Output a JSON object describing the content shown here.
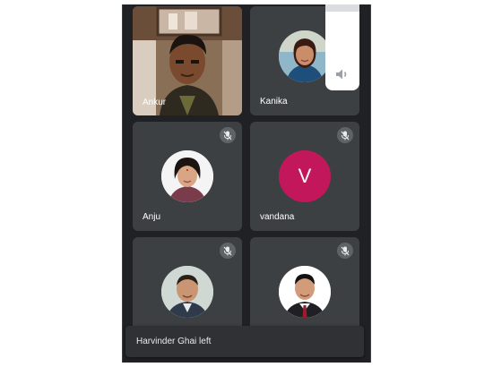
{
  "participants": [
    {
      "name": "Ankur",
      "type": "video",
      "muted": false
    },
    {
      "name": "Kanika",
      "type": "photo",
      "muted": false
    },
    {
      "name": "Anju",
      "type": "photo",
      "muted": true
    },
    {
      "name": "vandana",
      "type": "letter",
      "initial": "V",
      "avatar_color": "#c2185b",
      "muted": true
    },
    {
      "name": "",
      "type": "photo",
      "muted": true
    },
    {
      "name": "",
      "type": "photo",
      "muted": true
    }
  ],
  "volume_panel": {
    "icon": "speaker-icon",
    "level": 0.08
  },
  "toast": {
    "message": "Harvinder Ghai left"
  },
  "icons": {
    "mute": "mic-off-icon"
  },
  "colors": {
    "background": "#202124",
    "tile": "#3c4043",
    "toast": "#303134",
    "mute_badge": "#5f6368"
  }
}
